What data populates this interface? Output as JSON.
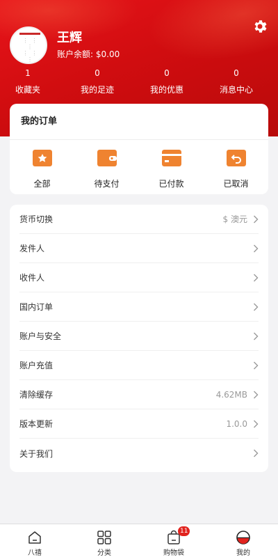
{
  "profile": {
    "name": "王辉",
    "balance": "账户余额: $0.00"
  },
  "stats": [
    {
      "count": "1",
      "label": "收藏夹"
    },
    {
      "count": "0",
      "label": "我的足迹"
    },
    {
      "count": "0",
      "label": "我的优惠"
    },
    {
      "count": "0",
      "label": "消息中心"
    }
  ],
  "orders": {
    "title": "我的订单",
    "items": [
      {
        "label": "全部",
        "icon": "star-icon"
      },
      {
        "label": "待支付",
        "icon": "wallet-icon"
      },
      {
        "label": "已付款",
        "icon": "card-icon"
      },
      {
        "label": "已取消",
        "icon": "return-icon"
      }
    ]
  },
  "menu": [
    {
      "label": "货币切换",
      "value": "$ 澳元"
    },
    {
      "label": "发件人",
      "value": ""
    },
    {
      "label": "收件人",
      "value": ""
    },
    {
      "label": "国内订单",
      "value": ""
    },
    {
      "label": "账户与安全",
      "value": ""
    },
    {
      "label": "账户充值",
      "value": ""
    },
    {
      "label": "清除缓存",
      "value": "4.62MB"
    },
    {
      "label": "版本更新",
      "value": "1.0.0"
    },
    {
      "label": "关于我们",
      "value": ""
    }
  ],
  "tabbar": {
    "items": [
      {
        "label": "八禧",
        "icon": "home-icon"
      },
      {
        "label": "分类",
        "icon": "grid-icon"
      },
      {
        "label": "购物袋",
        "icon": "bag-icon",
        "badge": "11"
      },
      {
        "label": "我的",
        "icon": "profile-icon"
      }
    ]
  },
  "colors": {
    "brand_red": "#d10d10",
    "order_icon_orange": "#ee7a24",
    "badge_red": "#e1231e"
  }
}
